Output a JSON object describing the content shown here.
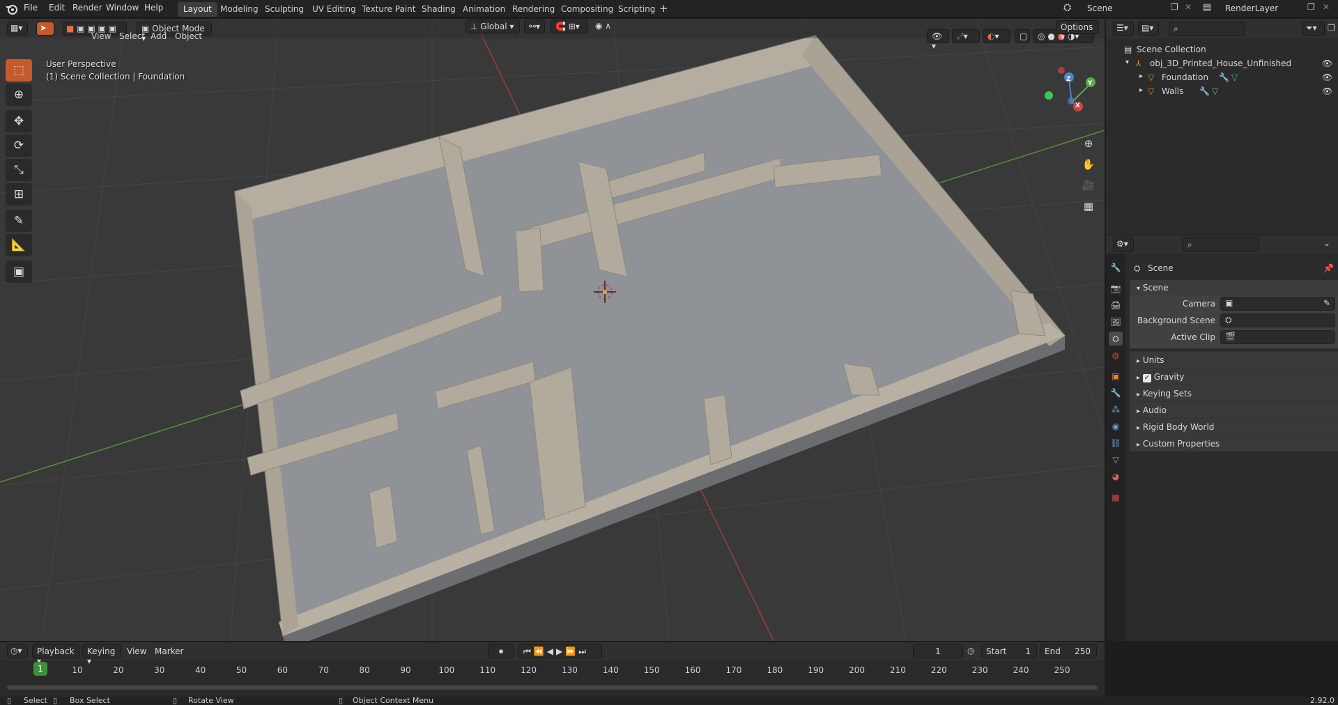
{
  "menu": {
    "file": "File",
    "edit": "Edit",
    "render": "Render",
    "window": "Window",
    "help": "Help"
  },
  "workspaces": [
    "Layout",
    "Modeling",
    "Sculpting",
    "UV Editing",
    "Texture Paint",
    "Shading",
    "Animation",
    "Rendering",
    "Compositing",
    "Scripting"
  ],
  "scene_field": "Scene",
  "render_layer_field": "RenderLayer",
  "viewport": {
    "mode": "Object Mode",
    "menus": {
      "view": "View",
      "select": "Select",
      "add": "Add",
      "object": "Object"
    },
    "orientation": "Global",
    "options": "Options",
    "perspective_label": "User Perspective",
    "collection_label": "(1) Scene Collection | Foundation",
    "gizmo": {
      "x": "X",
      "y": "Y",
      "z": "Z"
    }
  },
  "outliner": {
    "root": "Scene Collection",
    "items": [
      {
        "label": "obj_3D_Printed_House_Unfinished"
      },
      {
        "label": "Foundation"
      },
      {
        "label": "Walls"
      }
    ]
  },
  "properties": {
    "header_title": "Scene",
    "panel_title": "Scene",
    "rows": {
      "camera": "Camera",
      "background_scene": "Background Scene",
      "active_clip": "Active Clip"
    },
    "subpanels": {
      "units": "Units",
      "gravity": "Gravity",
      "keying_sets": "Keying Sets",
      "audio": "Audio",
      "rigid_body_world": "Rigid Body World",
      "custom_properties": "Custom Properties"
    },
    "gravity_checked": true
  },
  "timeline": {
    "menus": {
      "playback": "Playback",
      "keying": "Keying",
      "view": "View",
      "marker": "Marker"
    },
    "current_frame": "1",
    "start_label": "Start",
    "start": "1",
    "end_label": "End",
    "end": "250",
    "ticks": [
      "1",
      "10",
      "20",
      "30",
      "40",
      "50",
      "60",
      "70",
      "80",
      "90",
      "100",
      "110",
      "120",
      "130",
      "140",
      "150",
      "160",
      "170",
      "180",
      "190",
      "200",
      "210",
      "220",
      "230",
      "240",
      "250"
    ]
  },
  "statusbar": {
    "select": "Select",
    "box_select": "Box Select",
    "rotate_view": "Rotate View",
    "context_menu": "Object Context Menu",
    "version": "2.92.0"
  },
  "colors": {
    "accent": "#c55a2b",
    "active_frame": "#3e8e3e"
  }
}
